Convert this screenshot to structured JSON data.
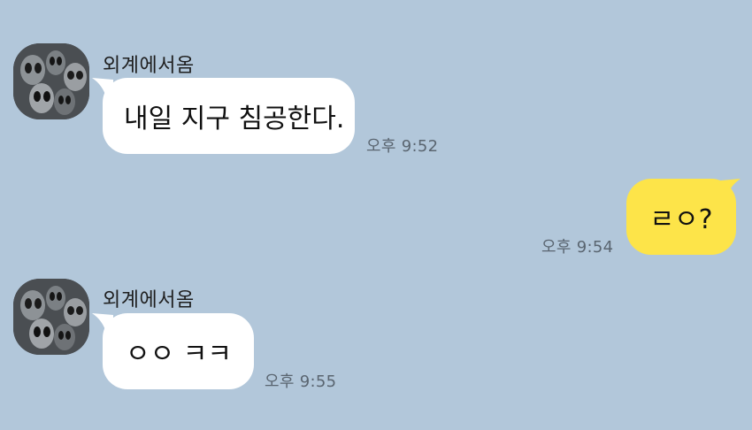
{
  "messages": [
    {
      "direction": "incoming",
      "sender": "외계에서옴",
      "text": "내일 지구 침공한다.",
      "time": "오후 9:52"
    },
    {
      "direction": "outgoing",
      "text": "ㄹㅇ?",
      "time": "오후 9:54"
    },
    {
      "direction": "incoming",
      "sender": "외계에서옴",
      "text": "ㅇㅇ ㅋㅋ",
      "time": "오후 9:55"
    }
  ],
  "colors": {
    "background": "#b2c7da",
    "incoming_bubble": "#ffffff",
    "outgoing_bubble": "#fde449"
  },
  "icons": {
    "avatar": "alien-group-avatar-icon"
  }
}
